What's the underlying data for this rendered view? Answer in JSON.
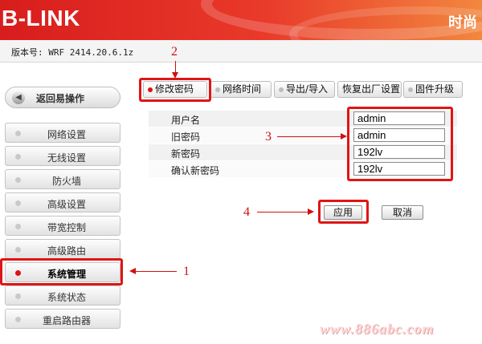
{
  "header": {
    "logo": "B-LINK",
    "slogan": "时尚",
    "version": "版本号: WRF 2414.20.6.1z",
    "brand_color": "#e02a22"
  },
  "sidebar": {
    "back_label": "返回易操作",
    "items": [
      {
        "label": "网络设置",
        "active": false
      },
      {
        "label": "无线设置",
        "active": false
      },
      {
        "label": "防火墙",
        "active": false
      },
      {
        "label": "高级设置",
        "active": false
      },
      {
        "label": "带宽控制",
        "active": false
      },
      {
        "label": "高级路由",
        "active": false
      },
      {
        "label": "系统管理",
        "active": true
      },
      {
        "label": "系统状态",
        "active": false
      },
      {
        "label": "重启路由器",
        "active": false
      }
    ]
  },
  "tabs": [
    {
      "label": "修改密码",
      "active": true
    },
    {
      "label": "网络时间",
      "active": false
    },
    {
      "label": "导出/导入",
      "active": false
    },
    {
      "label": "恢复出厂设置",
      "active": false
    },
    {
      "label": "固件升级",
      "active": false
    }
  ],
  "form": {
    "username_label": "用户名",
    "username_value": "admin",
    "old_password_label": "旧密码",
    "old_password_value": "admin",
    "new_password_label": "新密码",
    "new_password_value": "192lv",
    "confirm_password_label": "确认新密码",
    "confirm_password_value": "192lv"
  },
  "buttons": {
    "apply": "应用",
    "cancel": "取消"
  },
  "annotations": {
    "n1": "1",
    "n2": "2",
    "n3": "3",
    "n4": "4",
    "accent": "#e01515"
  },
  "watermark": "www.886abc.com"
}
